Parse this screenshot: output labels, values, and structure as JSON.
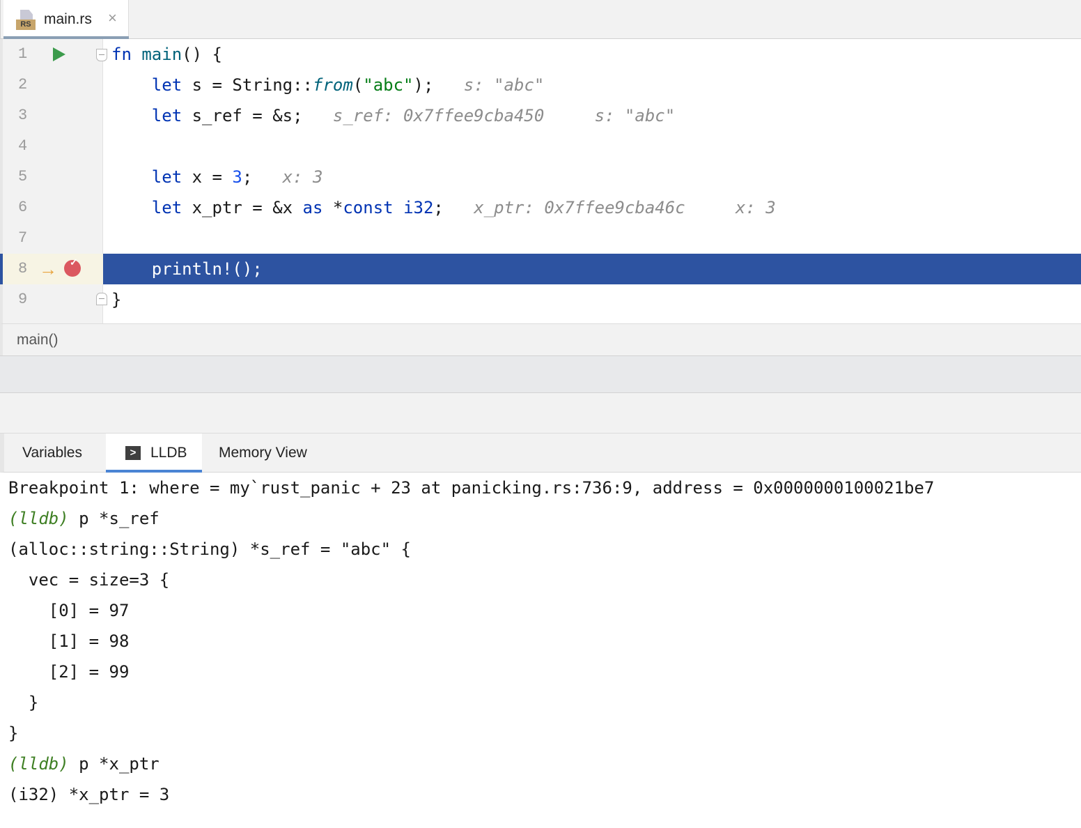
{
  "tab": {
    "badge": "RS",
    "label": "main.rs",
    "close": "×"
  },
  "code_lines": [
    {
      "no": "1",
      "parts": [
        {
          "t": "fn",
          "c": "kw"
        },
        {
          "t": " "
        },
        {
          "t": "main",
          "c": "fn"
        },
        {
          "t": "() {"
        }
      ]
    },
    {
      "no": "2",
      "parts": [
        {
          "t": "    "
        },
        {
          "t": "let",
          "c": "kw"
        },
        {
          "t": " s = String::"
        },
        {
          "t": "from",
          "c": "ital"
        },
        {
          "t": "("
        },
        {
          "t": "\"abc\"",
          "c": "str"
        },
        {
          "t": ");"
        },
        {
          "t": "   s: \"abc\"",
          "c": "hint"
        }
      ]
    },
    {
      "no": "3",
      "parts": [
        {
          "t": "    "
        },
        {
          "t": "let",
          "c": "kw"
        },
        {
          "t": " s_ref = &s;"
        },
        {
          "t": "   s_ref: 0x7ffee9cba450     s: \"abc\"",
          "c": "hint"
        }
      ]
    },
    {
      "no": "4",
      "parts": []
    },
    {
      "no": "5",
      "parts": [
        {
          "t": "    "
        },
        {
          "t": "let",
          "c": "kw"
        },
        {
          "t": " x = "
        },
        {
          "t": "3",
          "c": "num"
        },
        {
          "t": ";"
        },
        {
          "t": "   x: 3",
          "c": "hint"
        }
      ]
    },
    {
      "no": "6",
      "parts": [
        {
          "t": "    "
        },
        {
          "t": "let",
          "c": "kw"
        },
        {
          "t": " x_ptr = &x "
        },
        {
          "t": "as",
          "c": "kw"
        },
        {
          "t": " *"
        },
        {
          "t": "const",
          "c": "kw"
        },
        {
          "t": " "
        },
        {
          "t": "i32",
          "c": "kw"
        },
        {
          "t": ";"
        },
        {
          "t": "   x_ptr: 0x7ffee9cba46c     x: 3",
          "c": "hint"
        }
      ]
    },
    {
      "no": "7",
      "parts": []
    },
    {
      "no": "8",
      "parts": [
        {
          "t": "    println!();"
        }
      ]
    },
    {
      "no": "9",
      "parts": [
        {
          "t": "}"
        }
      ]
    }
  ],
  "breadcrumb": "main()",
  "debug_tabs": [
    {
      "label": "Variables"
    },
    {
      "label": "LLDB"
    },
    {
      "label": "Memory View"
    }
  ],
  "console_lines": [
    {
      "prompt": "",
      "text": "Breakpoint 1: where = my`rust_panic + 23 at panicking.rs:736:9, address = 0x0000000100021be7"
    },
    {
      "prompt": "(lldb)",
      "text": " p *s_ref"
    },
    {
      "prompt": "",
      "text": "(alloc::string::String) *s_ref = \"abc\" {"
    },
    {
      "prompt": "",
      "text": "  vec = size=3 {"
    },
    {
      "prompt": "",
      "text": "    [0] = 97"
    },
    {
      "prompt": "",
      "text": "    [1] = 98"
    },
    {
      "prompt": "",
      "text": "    [2] = 99"
    },
    {
      "prompt": "",
      "text": "  }"
    },
    {
      "prompt": "",
      "text": "}"
    },
    {
      "prompt": "(lldb)",
      "text": " p *x_ptr"
    },
    {
      "prompt": "",
      "text": "(i32) *x_ptr = 3"
    }
  ]
}
